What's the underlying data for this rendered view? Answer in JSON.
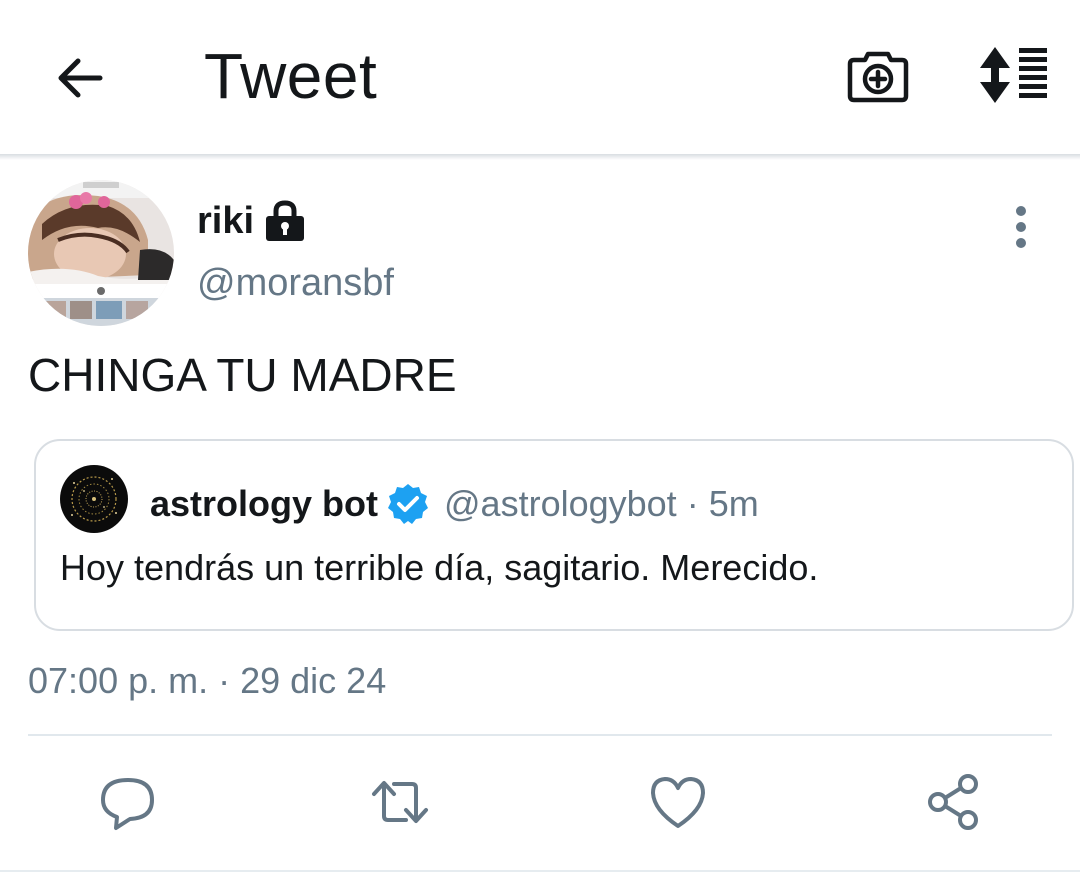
{
  "header": {
    "title": "Tweet",
    "back_icon": "arrow-left-icon",
    "camera_icon": "camera-plus-icon",
    "sort_icon": "sort-list-icon"
  },
  "tweet": {
    "author": {
      "name": "riki",
      "handle": "@moransbf",
      "protected_icon": "lock-icon"
    },
    "text": "CHINGA TU MADRE",
    "quoted": {
      "name": "astrology bot",
      "verified_icon": "verified-badge-icon",
      "handle": "@astrologybot",
      "separator": "·",
      "time": "5m",
      "text": "Hoy tendrás un terrible día, sagitario. Merecido."
    },
    "timestamp": {
      "time": "07:00 p. m.",
      "separator": "·",
      "date": "29 dic 24"
    }
  },
  "actions": {
    "reply_icon": "reply-icon",
    "retweet_icon": "retweet-icon",
    "like_icon": "heart-icon",
    "share_icon": "share-icon"
  },
  "colors": {
    "text_primary": "#14171a",
    "text_secondary": "#657786",
    "verified_blue": "#1da1f2",
    "border": "#d8dde2"
  }
}
